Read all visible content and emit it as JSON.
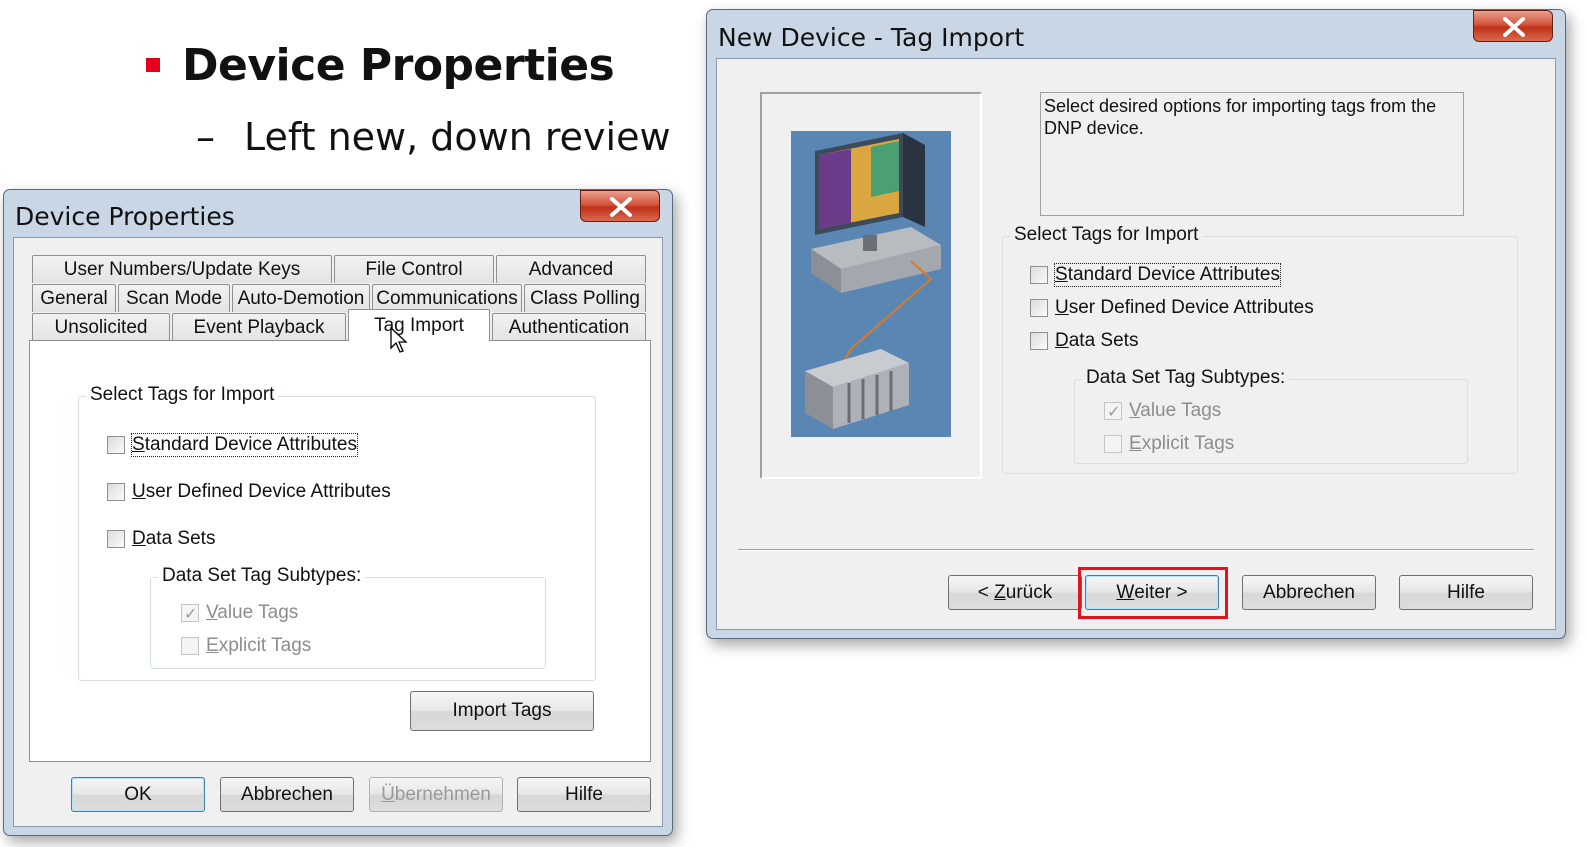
{
  "slide": {
    "title": "Device Properties",
    "dash": "–",
    "subtitle": "Left new, down review"
  },
  "device_properties": {
    "window_title": "Device Properties",
    "tabs_row1": [
      "User Numbers/Update Keys",
      "File Control",
      "Advanced"
    ],
    "tabs_row2": [
      "General",
      "Scan Mode",
      "Auto-Demotion",
      "Communications",
      "Class Polling"
    ],
    "tabs_row3": [
      "Unsolicited",
      "Event Playback",
      "Tag Import",
      "Authentication"
    ],
    "active_tab": "Tag Import",
    "group_label": "Select Tags for Import",
    "checkboxes": [
      {
        "pre": "",
        "ul": "S",
        "post": "tandard Device Attributes",
        "checked": false
      },
      {
        "pre": "",
        "ul": "U",
        "post": "ser Defined Device Attributes",
        "checked": false
      },
      {
        "pre": "",
        "ul": "D",
        "post": "ata Sets",
        "checked": false
      }
    ],
    "subgroup_label": "Data Set Tag Subtypes:",
    "subtypes": [
      {
        "pre": "",
        "ul": "V",
        "post": "alue Tags",
        "checked": true
      },
      {
        "pre": "",
        "ul": "E",
        "post": "xplicit Tags",
        "checked": false
      }
    ],
    "import_button": "Import Tags",
    "buttons": {
      "ok": "OK",
      "cancel": "Abbrechen",
      "apply_pre": "",
      "apply_ul": "Ü",
      "apply_post": "bernehmen",
      "help": "Hilfe"
    }
  },
  "new_device_tag_import": {
    "window_title": "New Device - Tag Import",
    "description": "Select desired options for importing tags from the DNP device.",
    "group_label": "Select Tags for Import",
    "checkboxes": [
      {
        "pre": "",
        "ul": "S",
        "post": "tandard Device Attributes",
        "checked": false
      },
      {
        "pre": "",
        "ul": "U",
        "post": "ser Defined Device Attributes",
        "checked": false
      },
      {
        "pre": "",
        "ul": "D",
        "post": "ata Sets",
        "checked": false
      }
    ],
    "subgroup_label": "Data Set Tag Subtypes:",
    "subtypes": [
      {
        "pre": "",
        "ul": "V",
        "post": "alue Tags",
        "checked": true
      },
      {
        "pre": "",
        "ul": "E",
        "post": "xplicit Tags",
        "checked": false
      }
    ],
    "buttons": {
      "back_pre": "< ",
      "back_ul": "Z",
      "back_post": "urück",
      "next_pre": "",
      "next_ul": "W",
      "next_post": "eiter >",
      "cancel": "Abbrechen",
      "help": "Hilfe"
    },
    "highlight_color": "#e0141e"
  }
}
